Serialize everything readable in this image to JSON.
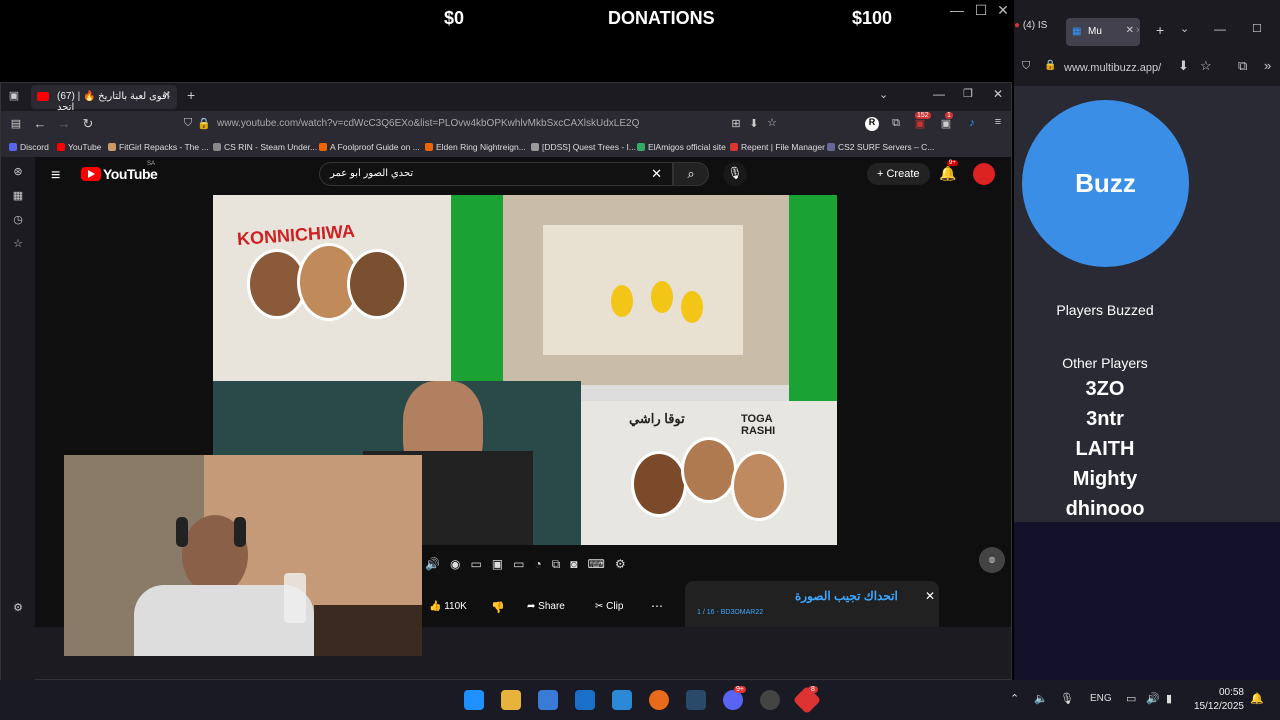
{
  "overlay": {
    "left_amount": "$0",
    "title": "DONATIONS",
    "right_amount": "$100"
  },
  "browser": {
    "tab_title": "(67) اقوى لعبة بالتاريخ 🔥 | اتحد",
    "url": "www.youtube.com/watch?v=cdWcC3Q6EXo&list=PLOvw4kbOPKwhlvMkbSxcCAXlskUdxLE2Q",
    "bookmarks": [
      "Discord",
      "YouTube",
      "FitGirl Repacks - The ...",
      "CS RIN - Steam Under...",
      "A Foolproof Guide on ...",
      "Elden Ring Nightreign...",
      "[DDSS] Quest Trees - I...",
      "ElAmigos official site",
      "Repent | File Manager",
      "CS2 SURF Servers – C..."
    ],
    "badges": {
      "b152": "152",
      "b1": "1"
    }
  },
  "youtube": {
    "logo": "YouTube",
    "region": "SA",
    "search_value": "تحدي الصور ابو عمر",
    "create_label": "Create",
    "notif_badge": "9+",
    "likes": "110K",
    "share_label": "Share",
    "clip_label": "Clip",
    "playlist_title": "اتحداك تجيب الصورة",
    "playlist_meta": "1 / 16 - BD3OMAR22",
    "thumb_text_1": "KONNICHIWA",
    "thumb_text_2": "TOGA RASHI",
    "thumb_text_3": "توقا راشي"
  },
  "rightapp": {
    "tab1": "(4) IS",
    "tab2": "Mu",
    "url": "www.multibuzz.app/",
    "buzz_label": "Buzz",
    "players_buzzed_label": "Players Buzzed",
    "other_players_label": "Other Players",
    "players": [
      "3ZO",
      "3ntr",
      "LAITH",
      "Mighty",
      "dhinooo"
    ]
  },
  "taskbar": {
    "lang": "ENG",
    "time": "00:58",
    "date": "15/12/2025",
    "discord_badge": "9+",
    "app_badge": "8"
  },
  "colors": {
    "buzz": "#3a8ee6",
    "yt_red": "#ff0000",
    "green": "#1aa334"
  }
}
